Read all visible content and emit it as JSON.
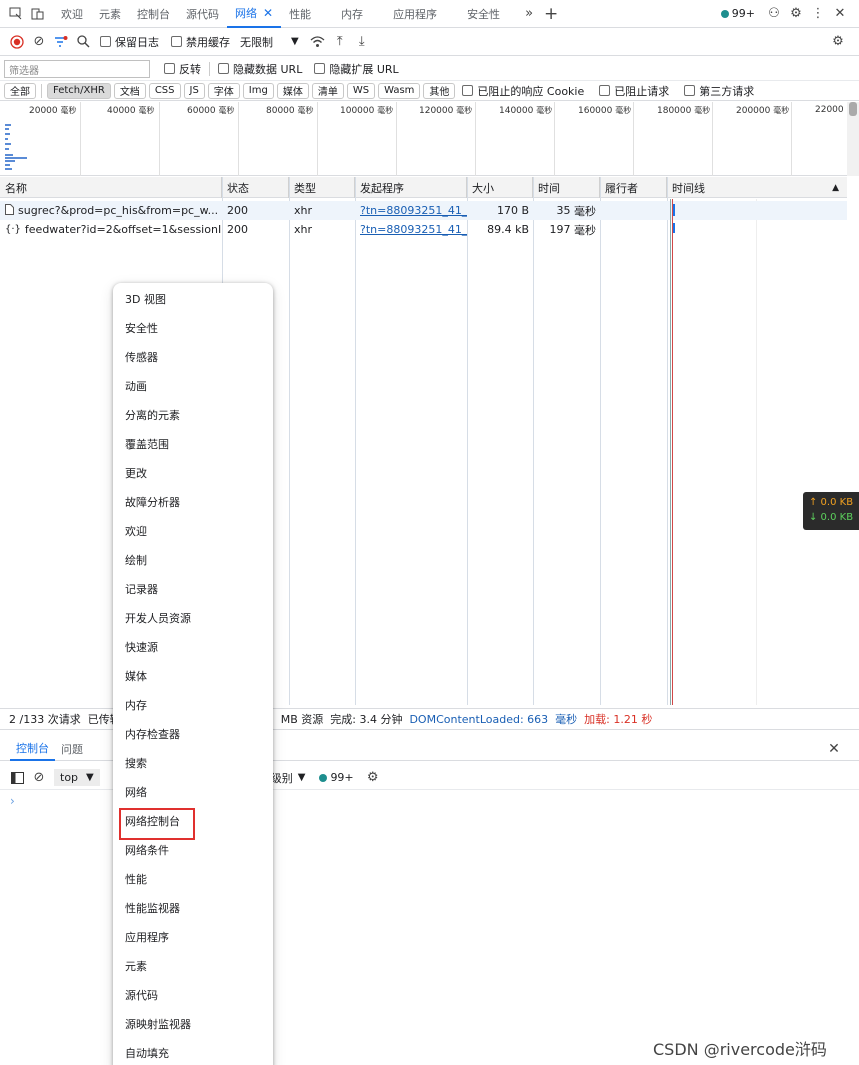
{
  "tabs": {
    "items": [
      "欢迎",
      "元素",
      "控制台",
      "源代码",
      "网络",
      "性能",
      "内存",
      "应用程序",
      "安全性"
    ],
    "active": "网络",
    "issues_count": "99+"
  },
  "toolbar": {
    "preserve_log": "保留日志",
    "disable_cache": "禁用缓存",
    "throttle": "无限制"
  },
  "filter": {
    "placeholder": "筛选器",
    "invert": "反转",
    "hide_data_urls": "隐藏数据 URL",
    "hide_ext_urls": "隐藏扩展 URL"
  },
  "types": {
    "all": "全部",
    "fetch": "Fetch/XHR",
    "doc": "文档",
    "css": "CSS",
    "js": "JS",
    "font": "字体",
    "img": "Img",
    "media": "媒体",
    "manifest": "清单",
    "ws": "WS",
    "wasm": "Wasm",
    "other": "其他",
    "blocked_cookies": "已阻止的响应 Cookie",
    "blocked_requests": "已阻止请求",
    "third_party": "第三方请求"
  },
  "overview": {
    "ticks": [
      "20000",
      "40000",
      "60000",
      "80000",
      "100000",
      "120000",
      "140000",
      "160000",
      "180000",
      "200000",
      "22000"
    ],
    "unit": "毫秒"
  },
  "table": {
    "headers": [
      "名称",
      "状态",
      "类型",
      "发起程序",
      "大小",
      "时间",
      "履行者",
      "时间线"
    ],
    "rows": [
      {
        "name": "sugrec?&prod=pc_his&from=pc_w...",
        "status": "200",
        "type": "xhr",
        "initiator": "?tn=88093251_41_ha",
        "size": "170 B",
        "time": "35",
        "time_unit": "毫秒",
        "fulfilled": ""
      },
      {
        "name": "feedwater?id=2&offset=1&sessionI...",
        "status": "200",
        "type": "xhr",
        "initiator": "?tn=88093251_41_ha",
        "size": "89.4 kB",
        "time": "197",
        "time_unit": "毫秒",
        "fulfilled": ""
      }
    ]
  },
  "status": {
    "requests": "2 /133 次请求",
    "transferred": "已传输",
    "resources": "MB 资源",
    "finish": "完成: 3.4 分钟",
    "dcl": "DOMContentLoaded: 663",
    "dcl_unit": "毫秒",
    "load": "加载: 1.21 秒"
  },
  "drawer": {
    "tabs": [
      "控制台",
      "问题"
    ],
    "context": "top",
    "levels": "认级别",
    "issues": "99+"
  },
  "menu": {
    "items": [
      "3D 视图",
      "安全性",
      "传感器",
      "动画",
      "分离的元素",
      "覆盖范围",
      "更改",
      "故障分析器",
      "欢迎",
      "绘制",
      "记录器",
      "开发人员资源",
      "快速源",
      "媒体",
      "内存",
      "内存检查器",
      "搜索",
      "网络",
      "网络控制台",
      "网络条件",
      "性能",
      "性能监视器",
      "应用程序",
      "元素",
      "源代码",
      "源映射监视器",
      "自动填充"
    ],
    "highlighted": "网络控制台"
  },
  "tooltip": {
    "up": "↑ 0.0 KB",
    "down": "↓ 0.0 KB"
  },
  "watermark": "CSDN @rivercode浒码",
  "colors": {
    "accent": "#1a73e8",
    "highlight": "#e0302e",
    "record": "#d93025"
  }
}
